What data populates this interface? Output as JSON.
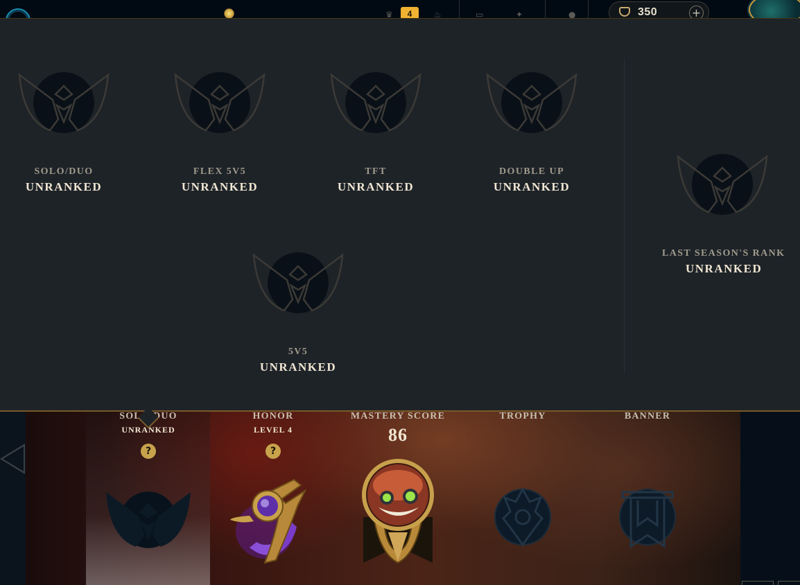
{
  "topbar": {
    "notification_count": "4",
    "currency_amount": "350",
    "currency_plus": "+"
  },
  "ranked_popup": {
    "queues": [
      {
        "queue": "SOLO/DUO",
        "tier": "UNRANKED"
      },
      {
        "queue": "FLEX 5V5",
        "tier": "UNRANKED"
      },
      {
        "queue": "TFT",
        "tier": "UNRANKED"
      },
      {
        "queue": "DOUBLE UP",
        "tier": "UNRANKED"
      },
      {
        "queue": "5V5",
        "tier": "UNRANKED"
      }
    ],
    "last_season": {
      "queue": "LAST SEASON'S RANK",
      "tier": "UNRANKED"
    }
  },
  "profile": {
    "solo_duo": {
      "label": "SOLO/DUO",
      "value": "UNRANKED",
      "help": "?"
    },
    "honor": {
      "label": "HONOR",
      "value": "LEVEL 4",
      "help": "?"
    },
    "mastery": {
      "label": "MASTERY SCORE",
      "value": "86"
    },
    "trophy": {
      "label": "TROPHY"
    },
    "banner": {
      "label": "BANNER"
    }
  },
  "colors": {
    "gold": "#c89b3c",
    "popup_bg": "#1e2328",
    "text_light": "#f0e6d2",
    "text_muted": "#a09b8c"
  }
}
